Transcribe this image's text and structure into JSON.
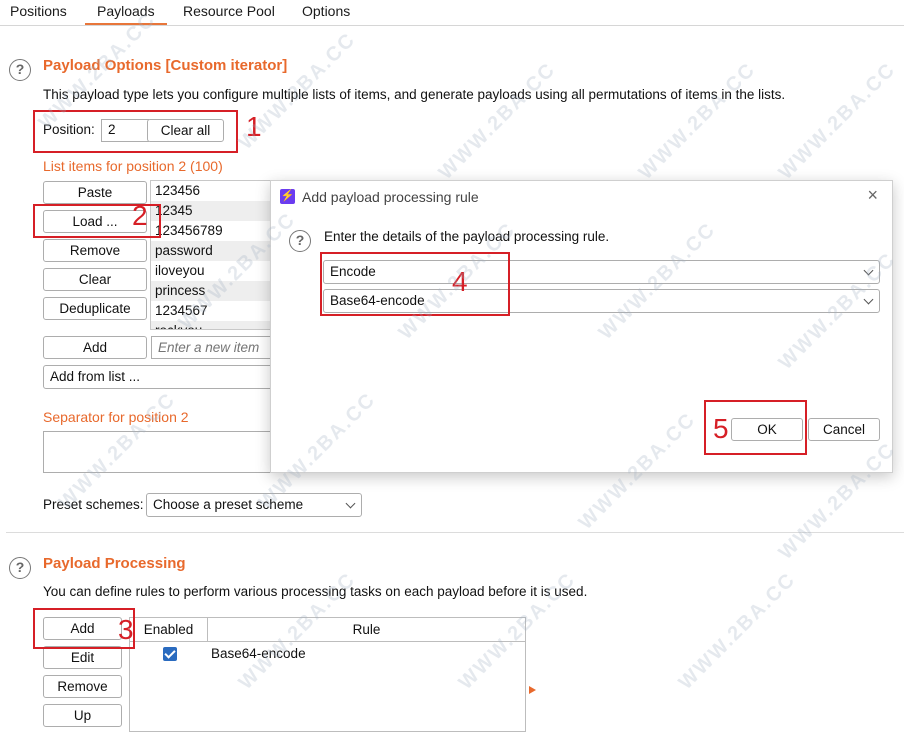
{
  "tabs": [
    "Positions",
    "Payloads",
    "Resource Pool",
    "Options"
  ],
  "payload_options": {
    "title": "Payload Options [Custom iterator]",
    "description": "This payload type lets you configure multiple lists of items, and generate payloads using all permutations of items in the lists.",
    "position_label": "Position:",
    "position_value": "2",
    "clear_all": "Clear all",
    "list_label": "List items for position 2 (100)",
    "buttons": {
      "paste": "Paste",
      "load": "Load ...",
      "remove": "Remove",
      "clear": "Clear",
      "deduplicate": "Deduplicate",
      "add": "Add"
    },
    "items": [
      "123456",
      "12345",
      "123456789",
      "password",
      "iloveyou",
      "princess",
      "1234567",
      "rockyou"
    ],
    "new_item_placeholder": "Enter a new item",
    "add_from_list": "Add from list ...",
    "separator_label": "Separator for position 2",
    "preset_label": "Preset schemes:",
    "preset_value": "Choose a preset scheme"
  },
  "payload_processing": {
    "title": "Payload Processing",
    "description": "You can define rules to perform various processing tasks on each payload before it is used.",
    "buttons": {
      "add": "Add",
      "edit": "Edit",
      "remove": "Remove",
      "up": "Up"
    },
    "columns": [
      "Enabled",
      "Rule"
    ],
    "rows": [
      {
        "enabled": true,
        "rule": "Base64-encode"
      }
    ]
  },
  "dialog": {
    "title": "Add payload processing rule",
    "prompt": "Enter the details of the payload processing rule.",
    "type_value": "Encode",
    "method_value": "Base64-encode",
    "ok": "OK",
    "cancel": "Cancel",
    "close_glyph": "×",
    "logo_glyph": "⚡"
  },
  "annotations": [
    "1",
    "2",
    "3",
    "4",
    "5"
  ],
  "watermark": "WWW.2BA.CC",
  "colors": {
    "accent": "#e8692c",
    "annotation_red": "#d61f26",
    "checkbox": "#2a6bbf"
  }
}
